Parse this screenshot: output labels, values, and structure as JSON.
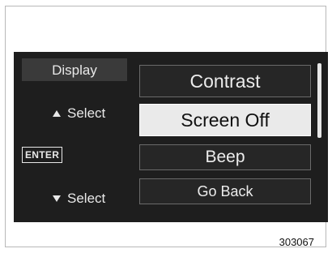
{
  "softkeys": {
    "display_label": "Display",
    "up_select_label": "Select",
    "enter_label": "ENTER",
    "down_select_label": "Select"
  },
  "menu": {
    "items": [
      {
        "label": "Contrast",
        "selected": false
      },
      {
        "label": "Screen Off",
        "selected": true
      },
      {
        "label": "Beep",
        "selected": false
      },
      {
        "label": "Go Back",
        "selected": false
      }
    ]
  },
  "figure_number": "303067",
  "colors": {
    "screen_background": "#1e1e1e",
    "selected_item_background": "#eaeaea",
    "text": "#e8e8e8"
  },
  "icons": {
    "up": "triangle-up-icon",
    "down": "triangle-down-icon",
    "enter": "enter-key-icon"
  }
}
